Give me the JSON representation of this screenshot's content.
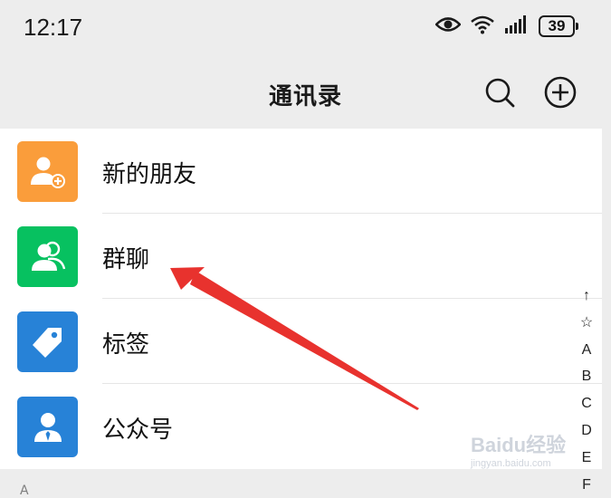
{
  "status_bar": {
    "time": "12:17",
    "battery": "39",
    "icons": [
      "eye-icon",
      "wifi-icon",
      "signal-icon",
      "battery-icon"
    ]
  },
  "header": {
    "title": "通讯录",
    "actions": [
      "search-icon",
      "plus-circle-icon"
    ]
  },
  "contacts_menu": {
    "items": [
      {
        "label": "新的朋友",
        "icon": "add-friend-icon",
        "color": "#FA9D3B"
      },
      {
        "label": "群聊",
        "icon": "group-chat-icon",
        "color": "#07C160"
      },
      {
        "label": "标签",
        "icon": "tag-icon",
        "color": "#2782D7"
      },
      {
        "label": "公众号",
        "icon": "official-account-icon",
        "color": "#2782D7"
      }
    ]
  },
  "section_header": "A",
  "index_bar": [
    "↑",
    "☆",
    "A",
    "B",
    "C",
    "D",
    "E",
    "F"
  ],
  "annotation": {
    "type": "arrow",
    "color": "#E8322E",
    "points_to": "群聊"
  },
  "watermark": {
    "text": "Baidu经验",
    "subtext": "jingyan.baidu.com"
  }
}
